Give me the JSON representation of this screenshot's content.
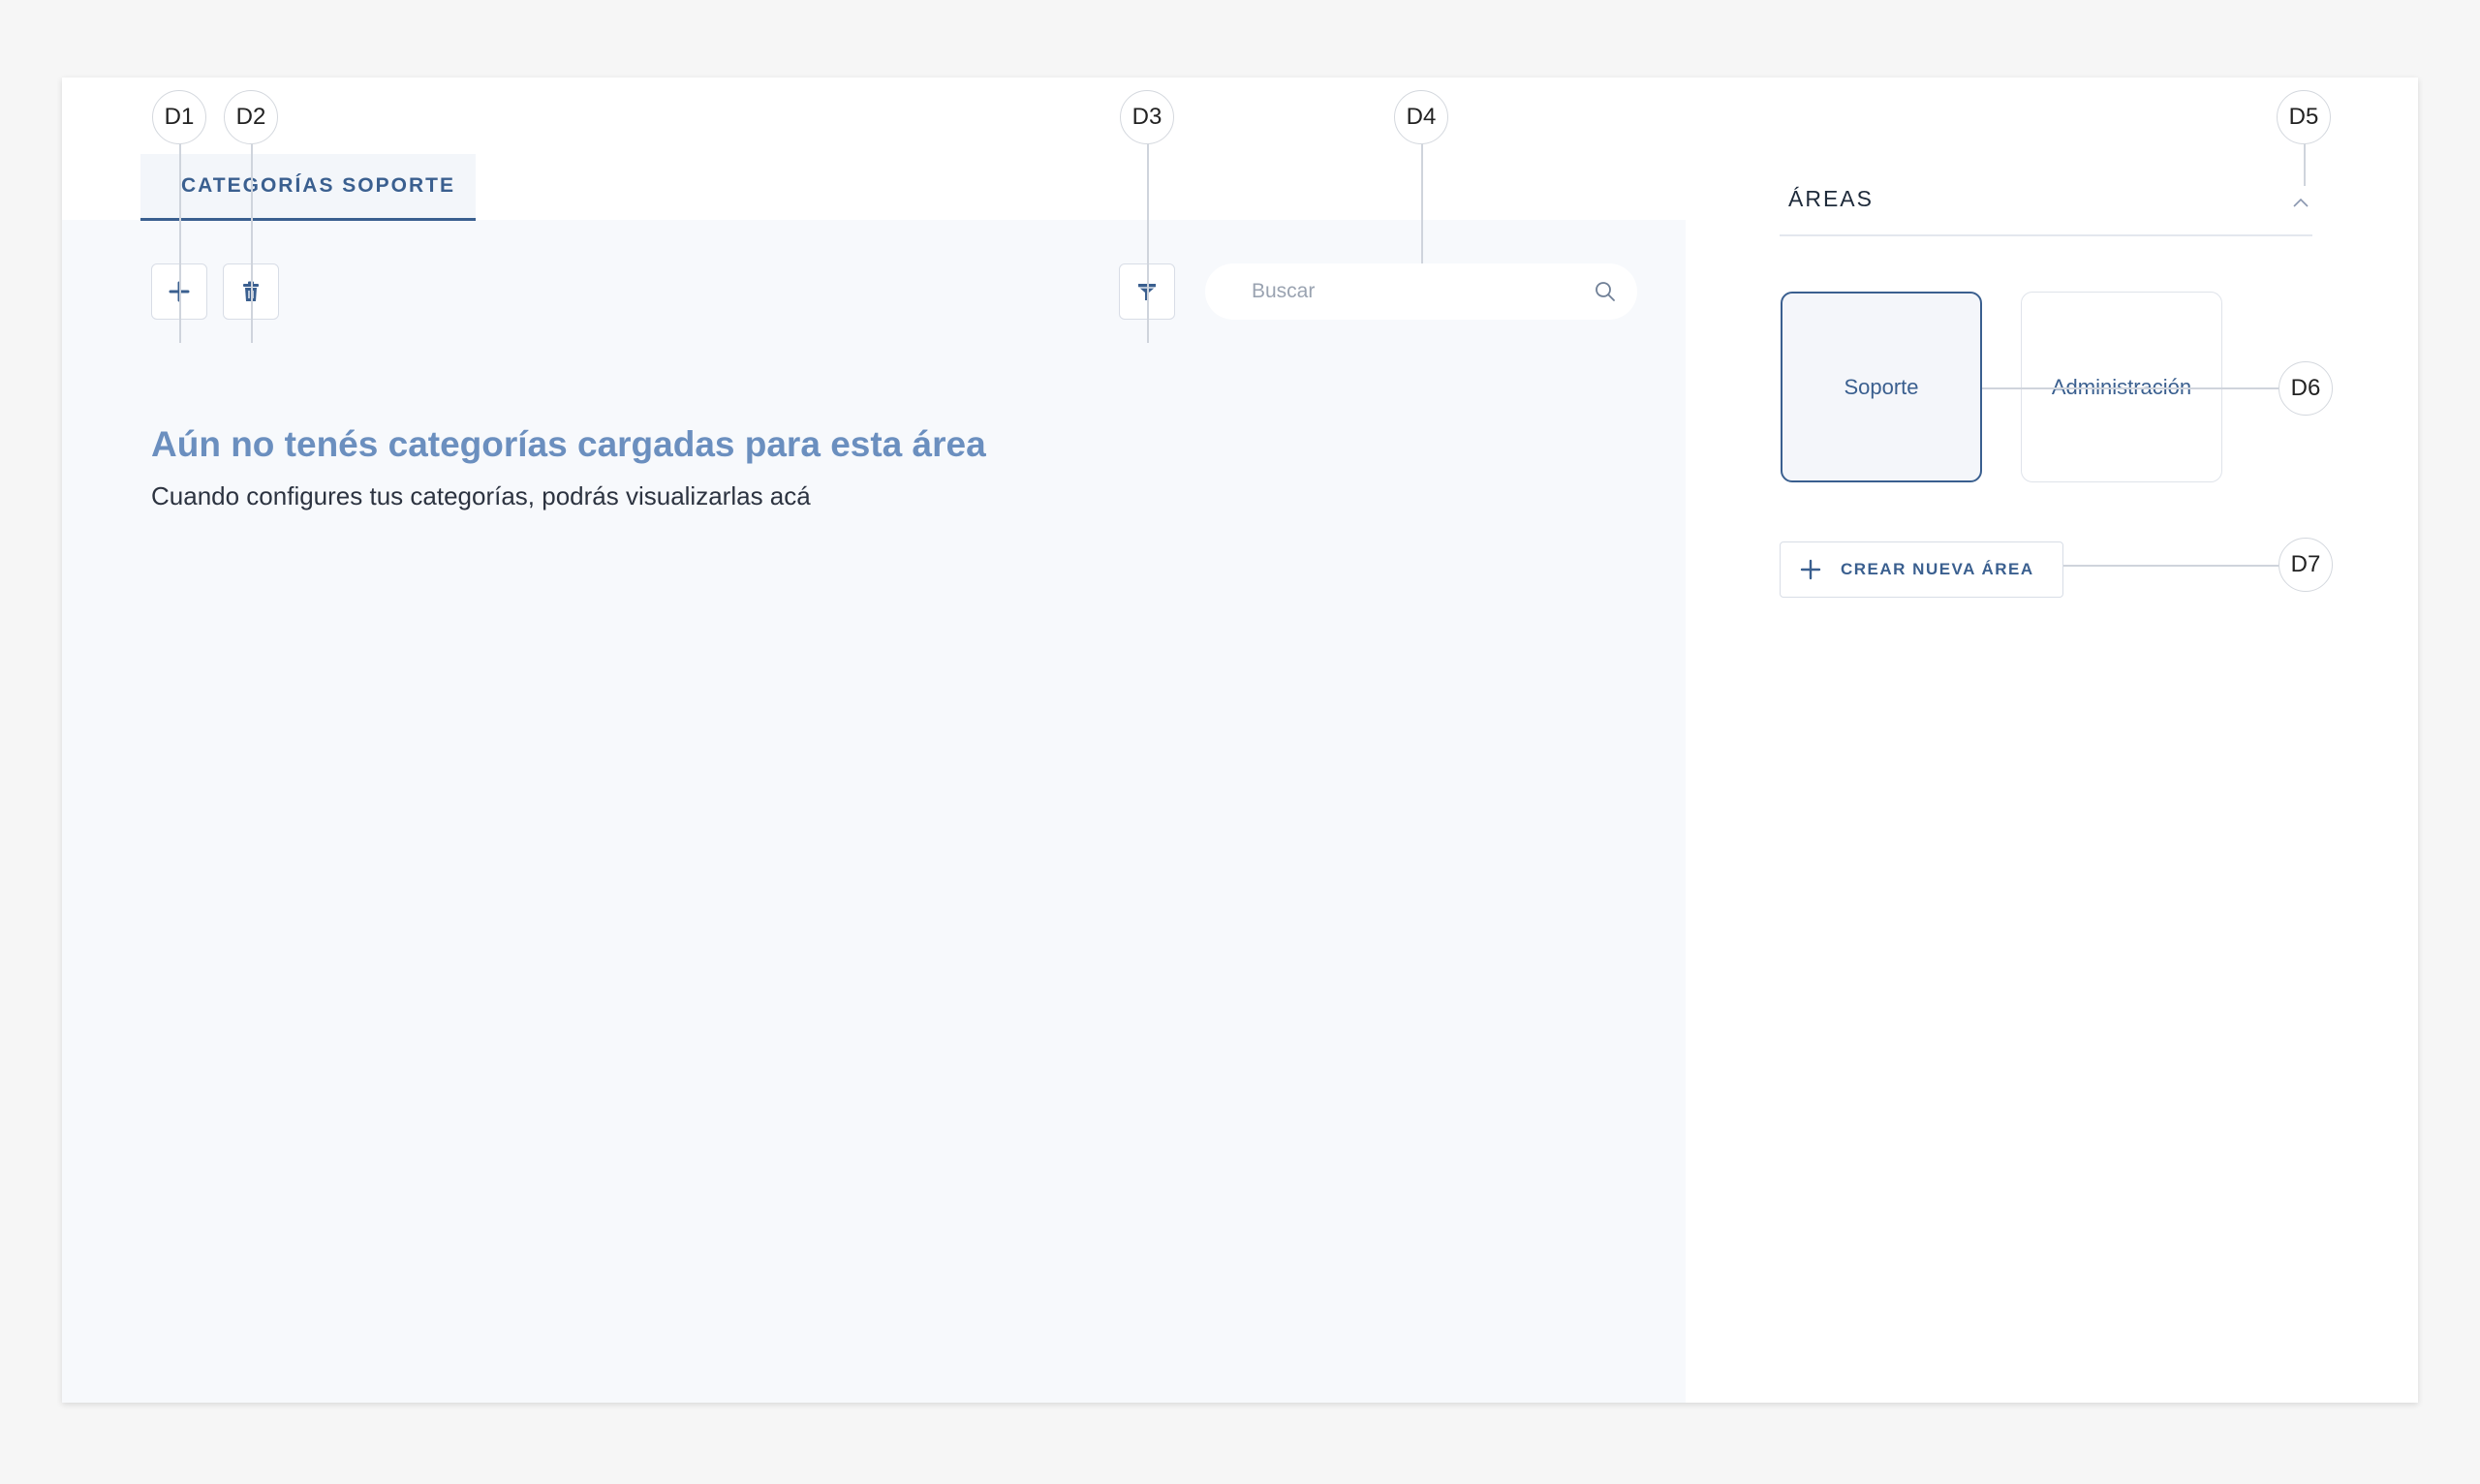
{
  "tab": {
    "label": "CATEGORÍAS SOPORTE"
  },
  "toolbar": {
    "add_icon": "plus-icon",
    "delete_icon": "trash-icon",
    "filter_icon": "filter-icon",
    "search_placeholder": "Buscar",
    "search_icon": "search-icon"
  },
  "empty_state": {
    "title": "Aún no tenés categorías cargadas para esta área",
    "subtitle": "Cuando configures tus categorías, podrás visualizarlas acá"
  },
  "areas": {
    "title": "ÁREAS",
    "collapse_icon": "chevron-up-icon",
    "items": [
      {
        "label": "Soporte",
        "selected": true
      },
      {
        "label": "Administración",
        "selected": false
      }
    ],
    "create_label": "CREAR NUEVA ÁREA"
  },
  "callouts": [
    "D1",
    "D2",
    "D3",
    "D4",
    "D5",
    "D6",
    "D7"
  ],
  "colors": {
    "accent": "#3a5f8f",
    "empty_title": "#6b8fbf",
    "panel_bg": "#f7f9fc"
  }
}
